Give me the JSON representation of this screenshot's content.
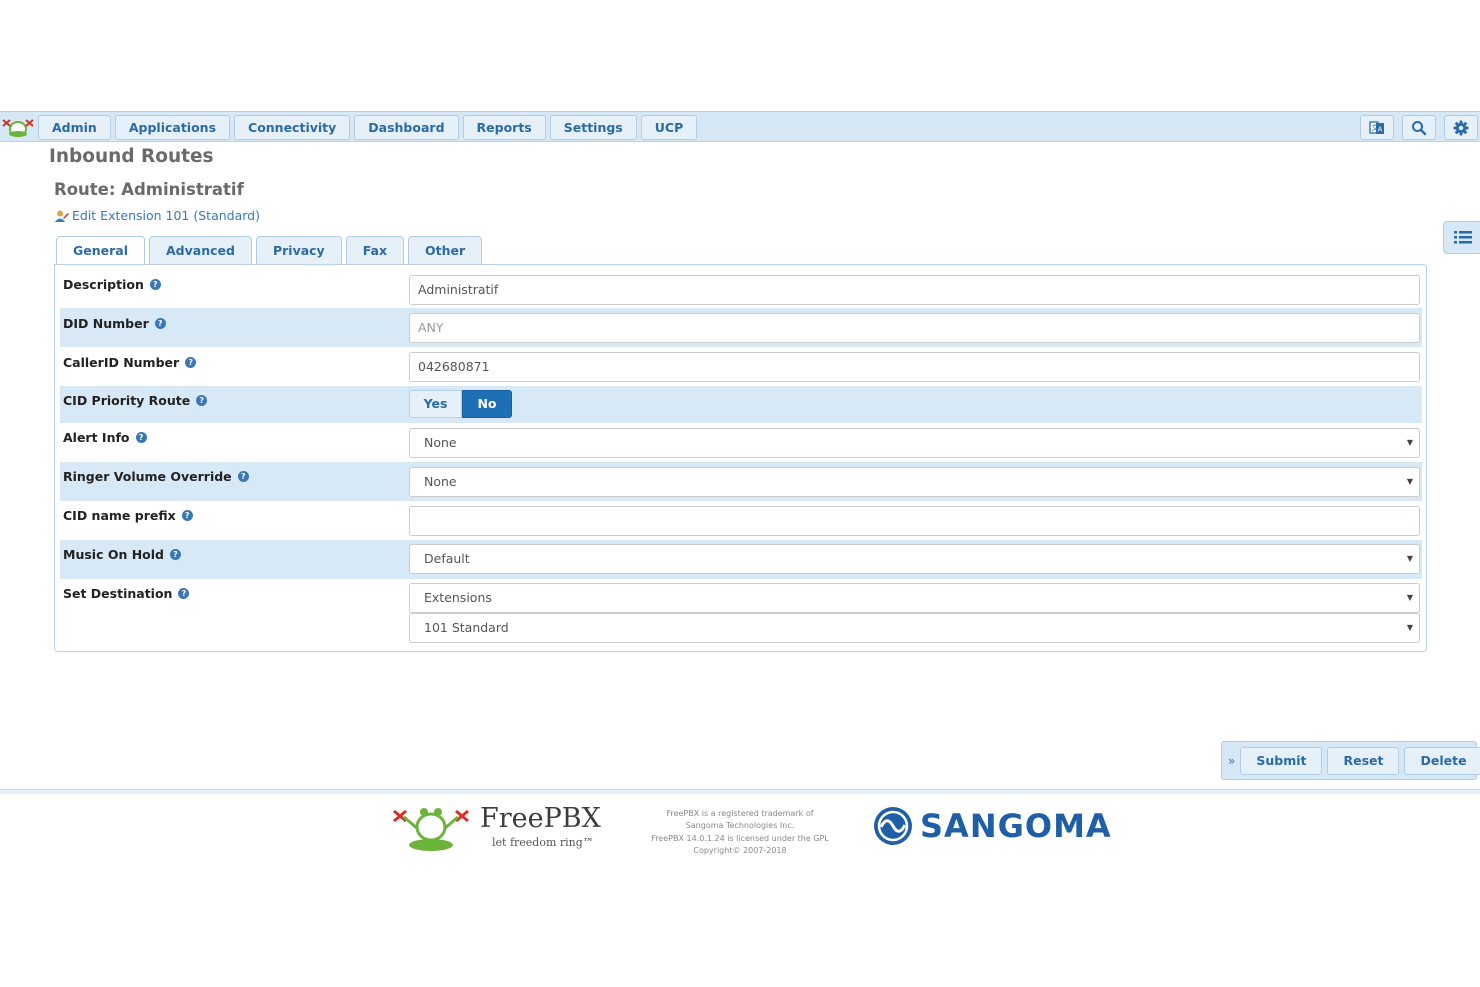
{
  "nav": {
    "items": [
      "Admin",
      "Applications",
      "Connectivity",
      "Dashboard",
      "Reports",
      "Settings",
      "UCP"
    ],
    "right_icons": [
      "translate-icon",
      "search-icon",
      "gear-icon"
    ]
  },
  "page": {
    "title": "Inbound Routes",
    "route_title": "Route: Administratif",
    "edit_link": "Edit Extension 101 (Standard)"
  },
  "tabs": [
    "General",
    "Advanced",
    "Privacy",
    "Fax",
    "Other"
  ],
  "active_tab": "General",
  "form": {
    "description": {
      "label": "Description",
      "value": "Administratif"
    },
    "did_number": {
      "label": "DID Number",
      "placeholder": "ANY",
      "value": ""
    },
    "callerid_number": {
      "label": "CallerID Number",
      "value": "042680871"
    },
    "cid_priority": {
      "label": "CID Priority Route",
      "yes": "Yes",
      "no": "No",
      "selected": "No"
    },
    "alert_info": {
      "label": "Alert Info",
      "value": "None"
    },
    "ringer_volume": {
      "label": "Ringer Volume Override",
      "value": "None"
    },
    "cid_prefix": {
      "label": "CID name prefix",
      "value": ""
    },
    "moh": {
      "label": "Music On Hold",
      "value": "Default"
    },
    "destination": {
      "label": "Set Destination",
      "type": "Extensions",
      "target": "101 Standard"
    }
  },
  "actions": {
    "submit": "Submit",
    "reset": "Reset",
    "delete": "Delete"
  },
  "footer": {
    "brand": "FreePBX",
    "tagline": "let freedom ring™",
    "legal": [
      "FreePBX is a registered trademark of",
      "Sangoma Technologies Inc.",
      "FreePBX 14.0.1.24 is licensed under the GPL",
      "Copyright© 2007-2018"
    ],
    "partner": "SANGOMA"
  },
  "colors": {
    "accent": "#2a6aa5",
    "bar": "#d6e7f6",
    "active_toggle": "#1f6fb6",
    "sangoma": "#1e5fa8"
  }
}
